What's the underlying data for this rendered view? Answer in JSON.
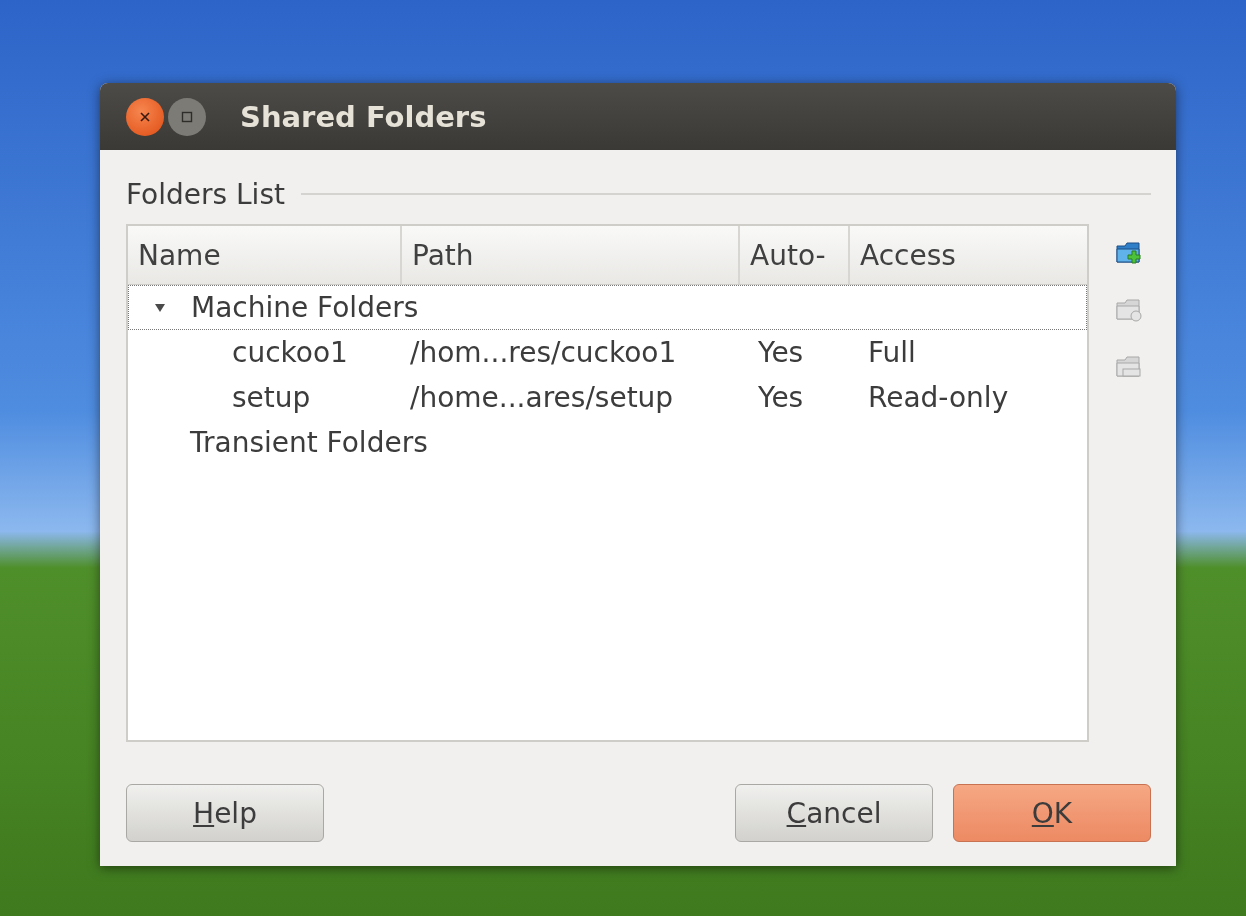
{
  "window": {
    "title": "Shared Folders"
  },
  "group": {
    "title": "Folders List"
  },
  "table": {
    "columns": [
      "Name",
      "Path",
      "Auto-",
      "Access"
    ],
    "rows": [
      {
        "name": "Machine Folders",
        "expanded": true,
        "focused": true,
        "children": [
          {
            "name": "cuckoo1",
            "path": "/hom...res/cuckoo1",
            "auto": "Yes",
            "access": "Full"
          },
          {
            "name": "setup",
            "path": "/home...ares/setup",
            "auto": "Yes",
            "access": "Read-only"
          }
        ]
      },
      {
        "name": "Transient Folders",
        "focused": false
      }
    ]
  },
  "tools": [
    {
      "kind": "add",
      "disabled": false
    },
    {
      "kind": "edit",
      "disabled": true
    },
    {
      "kind": "remove",
      "disabled": true
    }
  ],
  "buttons": [
    {
      "label": "Help",
      "default": false
    },
    {
      "label": "Cancel",
      "default": false
    },
    {
      "label": "OK",
      "default": true
    }
  ]
}
